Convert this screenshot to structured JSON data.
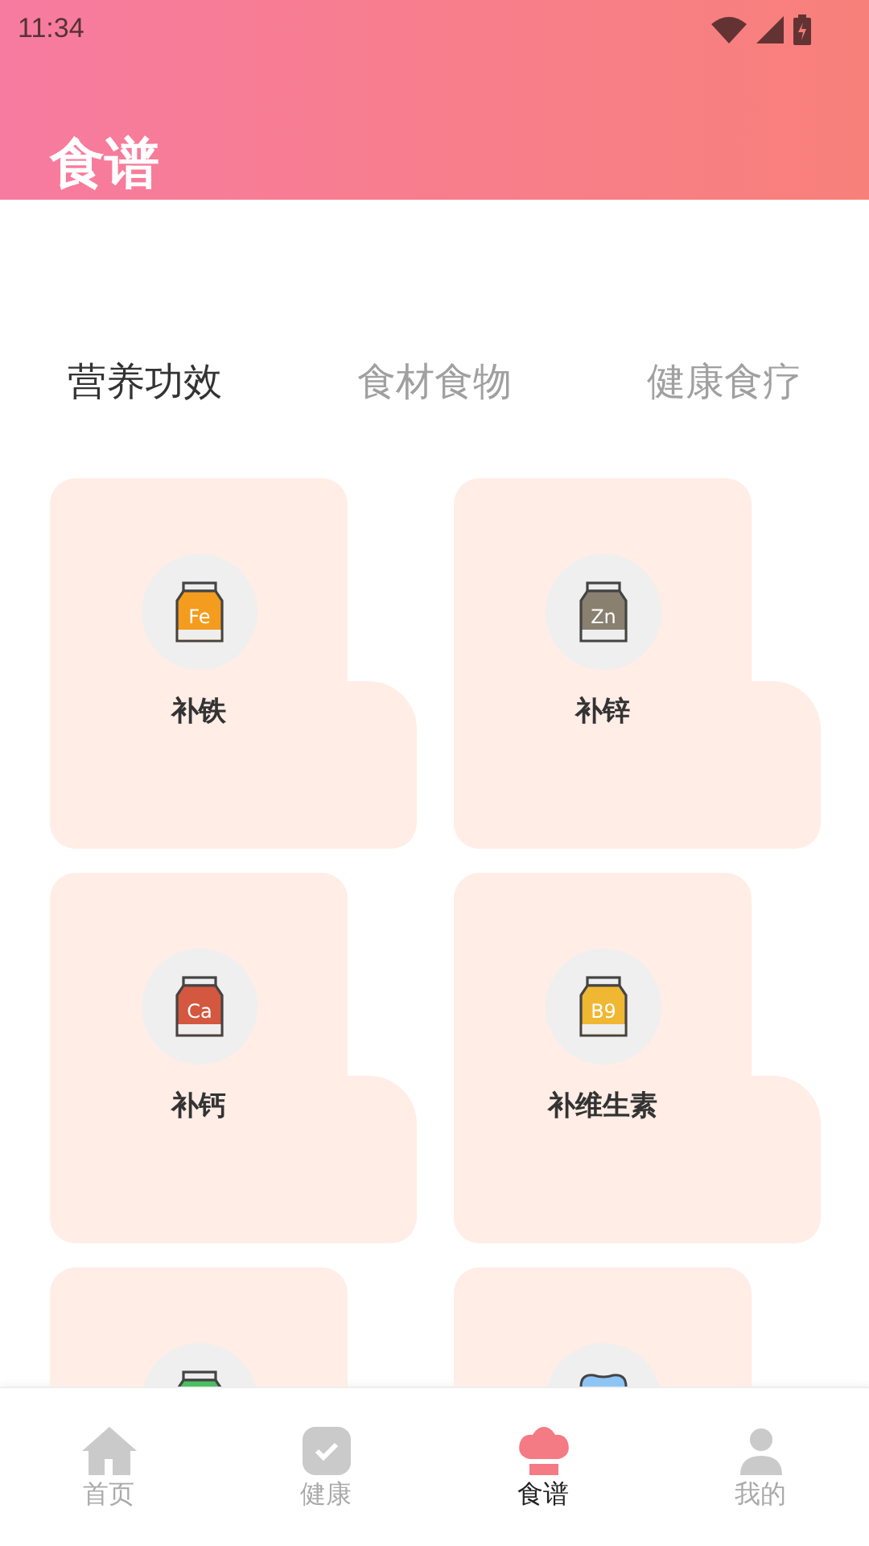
{
  "status_bar": {
    "time": "11:34"
  },
  "header": {
    "title": "食谱"
  },
  "tabs": [
    {
      "label": "营养功效",
      "selected": true
    },
    {
      "label": "食材食物",
      "selected": false
    },
    {
      "label": "健康食疗",
      "selected": false
    }
  ],
  "items": [
    {
      "label": "补铁",
      "kind": "jar",
      "symbol": "Fe",
      "color": "#f39c1e"
    },
    {
      "label": "补锌",
      "kind": "jar",
      "symbol": "Zn",
      "color": "#8a8070"
    },
    {
      "label": "补钙",
      "kind": "jar",
      "symbol": "Ca",
      "color": "#d4573f"
    },
    {
      "label": "补维生素",
      "kind": "jar",
      "symbol": "B9",
      "color": "#f0b733"
    },
    {
      "kind": "jar",
      "color": "#4cbf63"
    },
    {
      "kind": "tooth",
      "color": "#8ec5f5"
    }
  ],
  "nav": [
    {
      "label": "首页",
      "kind": "home",
      "selected": false
    },
    {
      "label": "健康",
      "kind": "check",
      "selected": false
    },
    {
      "label": "食谱",
      "kind": "chef",
      "selected": true
    },
    {
      "label": "我的",
      "kind": "person",
      "selected": false
    }
  ]
}
